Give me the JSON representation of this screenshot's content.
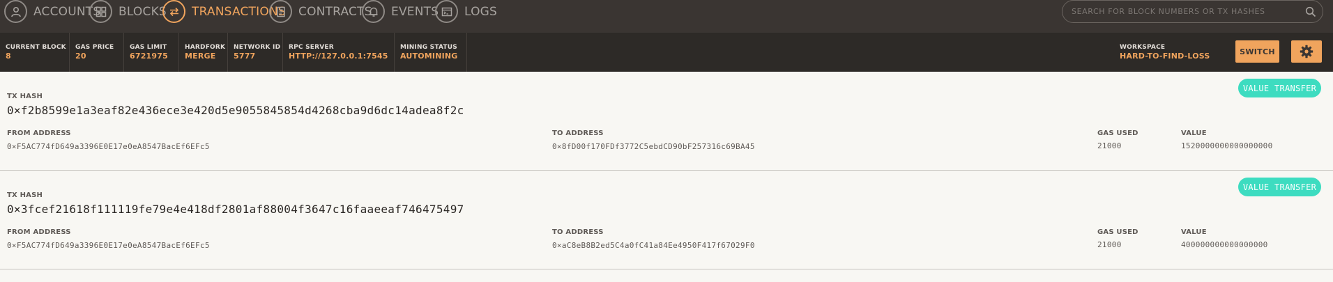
{
  "nav": {
    "items": [
      {
        "label": "ACCOUNTS",
        "icon": "accounts-icon",
        "active": false
      },
      {
        "label": "BLOCKS",
        "icon": "blocks-icon",
        "active": false
      },
      {
        "label": "TRANSACTIONS",
        "icon": "transactions-icon",
        "active": true
      },
      {
        "label": "CONTRACTS",
        "icon": "contracts-icon",
        "active": false
      },
      {
        "label": "EVENTS",
        "icon": "events-icon",
        "active": false
      },
      {
        "label": "LOGS",
        "icon": "logs-icon",
        "active": false
      }
    ],
    "search_placeholder": "SEARCH FOR BLOCK NUMBERS OR TX HASHES"
  },
  "status": {
    "current_block": {
      "label": "CURRENT BLOCK",
      "value": "8"
    },
    "gas_price": {
      "label": "GAS PRICE",
      "value": "20"
    },
    "gas_limit": {
      "label": "GAS LIMIT",
      "value": "6721975"
    },
    "hardfork": {
      "label": "HARDFORK",
      "value": "MERGE"
    },
    "network_id": {
      "label": "NETWORK ID",
      "value": "5777"
    },
    "rpc_server": {
      "label": "RPC SERVER",
      "value": "HTTP://127.0.0.1:7545"
    },
    "mining_status": {
      "label": "MINING STATUS",
      "value": "AUTOMINING"
    },
    "workspace": {
      "label": "WORKSPACE",
      "value": "HARD-TO-FIND-LOSS"
    },
    "switch_label": "SWITCH"
  },
  "transactions": [
    {
      "hash_label": "TX HASH",
      "hash": "0×f2b8599e1a3eaf82e436ece3e420d5e9055845854d4268cba9d6dc14adea8f2c",
      "type": "VALUE TRANSFER",
      "from_label": "FROM ADDRESS",
      "from": "0×F5AC774fD649a3396E0E17e0eA8547BacEf6EFc5",
      "to_label": "TO ADDRESS",
      "to": "0×8fD00f170FDf3772C5ebdCD90bF257316c69BA45",
      "gas_label": "GAS USED",
      "gas": "21000",
      "value_label": "VALUE",
      "value": "1520000000000000000"
    },
    {
      "hash_label": "TX HASH",
      "hash": "0×3fcef21618f111119fe79e4e418df2801af88004f3647c16faaeeaf746475497",
      "type": "VALUE TRANSFER",
      "from_label": "FROM ADDRESS",
      "from": "0×F5AC774fD649a3396E0E17e0eA8547BacEf6EFc5",
      "to_label": "TO ADDRESS",
      "to": "0×aC8eB8B2ed5C4a0fC41a84Ee4950F417f67029F0",
      "gas_label": "GAS USED",
      "gas": "21000",
      "value_label": "VALUE",
      "value": "400000000000000000"
    }
  ],
  "colors": {
    "accent": "#f0a45d",
    "badge": "#3ddcc0",
    "nav_bg": "#3a3532",
    "status_bg": "#2d2a27"
  }
}
